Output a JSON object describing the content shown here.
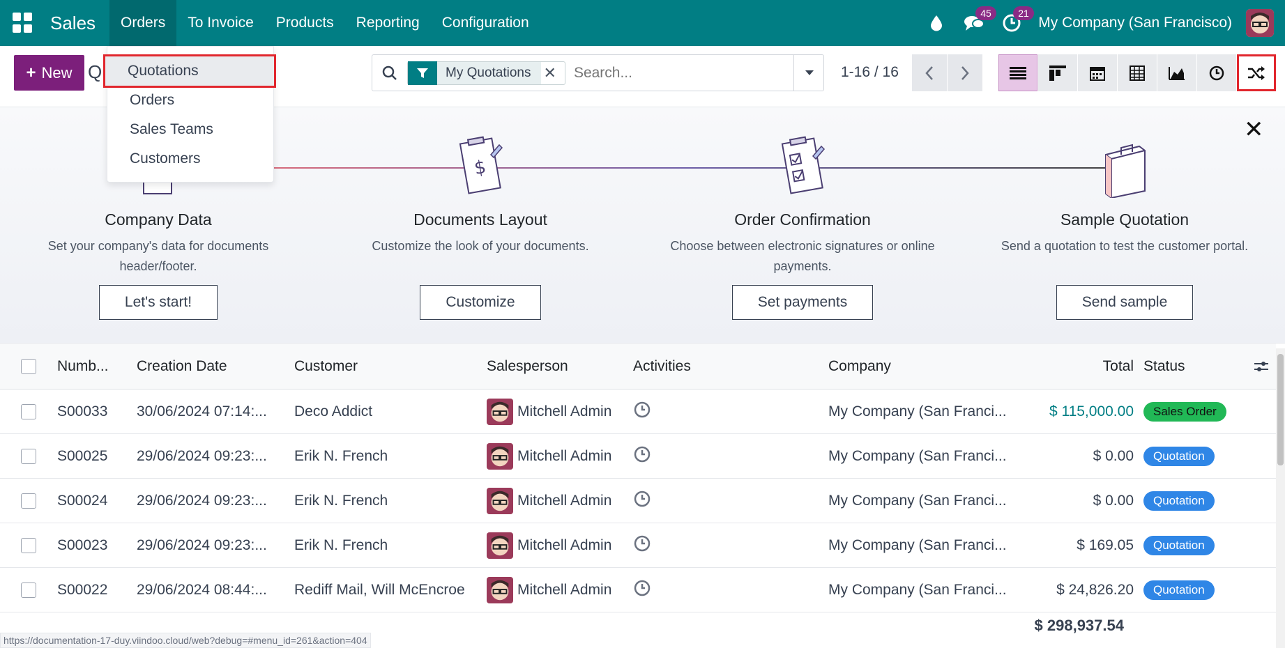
{
  "topbar": {
    "brand": "Sales",
    "menu": [
      "Orders",
      "To Invoice",
      "Products",
      "Reporting",
      "Configuration"
    ],
    "messages_count": "45",
    "activities_count": "21",
    "company": "My Company (San Francisco)"
  },
  "control": {
    "new_label": "New",
    "title_partial": "Qu",
    "facet": "My Quotations",
    "search_placeholder": "Search...",
    "pager": "1-16 / 16"
  },
  "dropdown": {
    "items": [
      "Quotations",
      "Orders",
      "Sales Teams",
      "Customers"
    ]
  },
  "onboarding": {
    "steps": [
      {
        "title": "Company Data",
        "desc": "Set your company's data for documents header/footer.",
        "button": "Let's start!"
      },
      {
        "title": "Documents Layout",
        "desc": "Customize the look of your documents.",
        "button": "Customize"
      },
      {
        "title": "Order Confirmation",
        "desc": "Choose between electronic signatures or online payments.",
        "button": "Set payments"
      },
      {
        "title": "Sample Quotation",
        "desc": "Send a quotation to test the customer portal.",
        "button": "Send sample"
      }
    ]
  },
  "table": {
    "headers": [
      "Numb...",
      "Creation Date",
      "Customer",
      "Salesperson",
      "Activities",
      "Company",
      "Total",
      "Status"
    ],
    "rows": [
      {
        "number": "S00033",
        "date": "30/06/2024 07:14:...",
        "customer": "Deco Addict",
        "salesperson": "Mitchell Admin",
        "company": "My Company (San Franci...",
        "total": "$ 115,000.00",
        "status": "Sales Order"
      },
      {
        "number": "S00025",
        "date": "29/06/2024 09:23:...",
        "customer": "Erik N. French",
        "salesperson": "Mitchell Admin",
        "company": "My Company (San Franci...",
        "total": "$ 0.00",
        "status": "Quotation"
      },
      {
        "number": "S00024",
        "date": "29/06/2024 09:23:...",
        "customer": "Erik N. French",
        "salesperson": "Mitchell Admin",
        "company": "My Company (San Franci...",
        "total": "$ 0.00",
        "status": "Quotation"
      },
      {
        "number": "S00023",
        "date": "29/06/2024 09:23:...",
        "customer": "Erik N. French",
        "salesperson": "Mitchell Admin",
        "company": "My Company (San Franci...",
        "total": "$ 169.05",
        "status": "Quotation"
      },
      {
        "number": "S00022",
        "date": "29/06/2024 08:44:...",
        "customer": "Rediff Mail, Will McEncroe",
        "salesperson": "Mitchell Admin",
        "company": "My Company (San Franci...",
        "total": "$ 24,826.20",
        "status": "Quotation"
      }
    ],
    "sum_total": "$ 298,937.54"
  },
  "status_url": "https://documentation-17-duy.viindoo.cloud/web?debug=#menu_id=261&action=404",
  "colors": {
    "brand": "#017e84",
    "primary": "#7c1f7b",
    "highlight": "#e1262d",
    "sales_order": "#21b856",
    "quotation": "#2f86e6"
  }
}
